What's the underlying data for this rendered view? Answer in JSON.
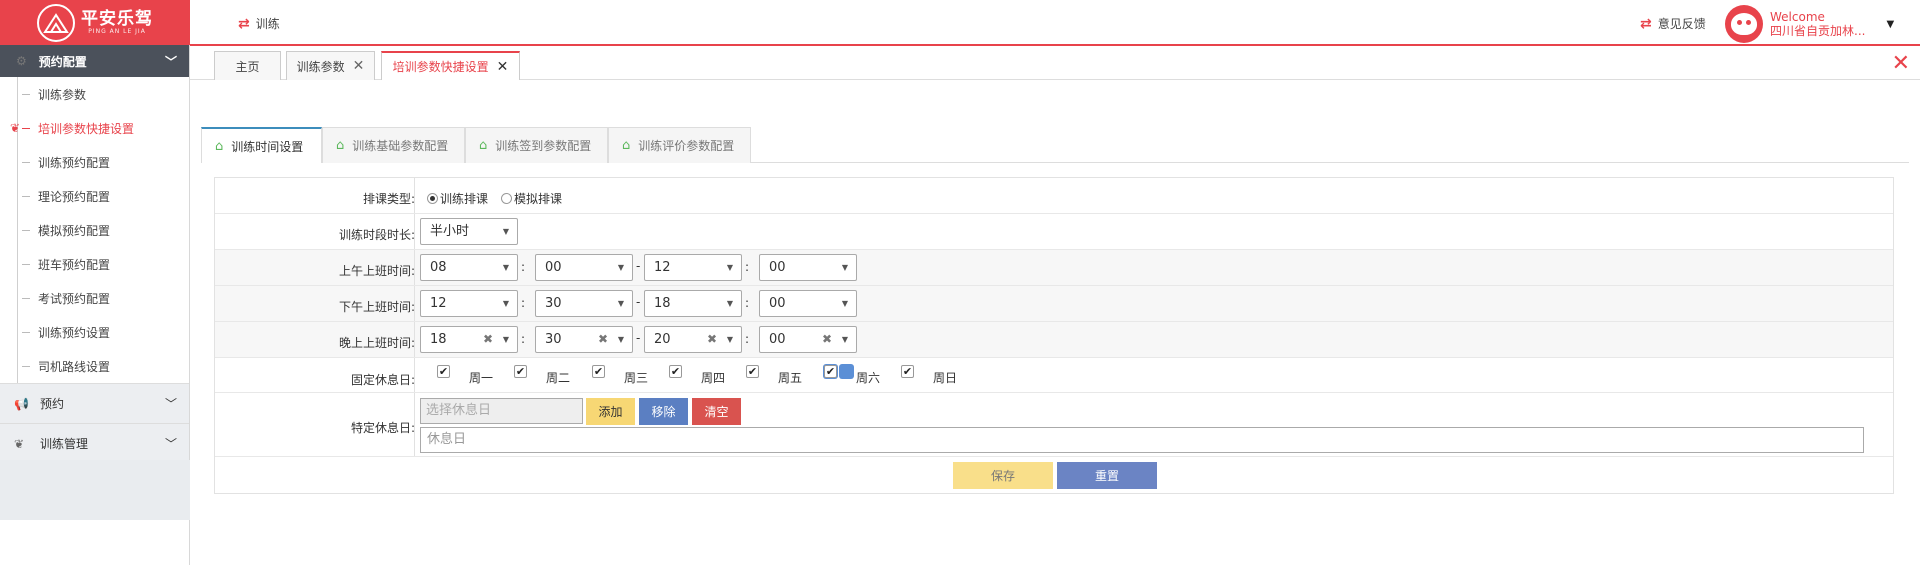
{
  "logo": {
    "name": "平安乐驾",
    "sub": "PING AN LE JIA"
  },
  "header": {
    "nav_label": "训练",
    "feedback_label": "意见反馈",
    "welcome": "Welcome",
    "user_org": "四川省自贡加林..."
  },
  "sidebar": {
    "group_open": "预约配置",
    "items": [
      {
        "label": "训练参数",
        "active": false
      },
      {
        "label": "培训参数快捷设置",
        "active": true
      },
      {
        "label": "训练预约配置",
        "active": false
      },
      {
        "label": "理论预约配置",
        "active": false
      },
      {
        "label": "模拟预约配置",
        "active": false
      },
      {
        "label": "班车预约配置",
        "active": false
      },
      {
        "label": "考试预约配置",
        "active": false
      },
      {
        "label": "训练预约设置",
        "active": false
      },
      {
        "label": "司机路线设置",
        "active": false
      }
    ],
    "groups": [
      {
        "label": "预约",
        "icon": "megaphone-icon"
      },
      {
        "label": "训练管理",
        "icon": "leaf-icon"
      }
    ]
  },
  "tabs": [
    {
      "label": "主页"
    },
    {
      "label": "训练参数"
    },
    {
      "label": "培训参数快捷设置"
    }
  ],
  "inner_tabs": [
    {
      "label": "训练时间设置"
    },
    {
      "label": "训练基础参数配置"
    },
    {
      "label": "训练签到参数配置"
    },
    {
      "label": "训练评价参数配置"
    }
  ],
  "form": {
    "schedule_type": {
      "label": "排课类型:",
      "options": [
        {
          "label": "训练排课",
          "selected": true
        },
        {
          "label": "模拟排课",
          "selected": false
        }
      ]
    },
    "duration": {
      "label": "训练时段时长:",
      "value": "半小时"
    },
    "morning": {
      "label": "上午上班时间:",
      "start_h": "08",
      "start_m": "00",
      "end_h": "12",
      "end_m": "00"
    },
    "afternoon": {
      "label": "下午上班时间:",
      "start_h": "12",
      "start_m": "30",
      "end_h": "18",
      "end_m": "00"
    },
    "evening": {
      "label": "晚上上班时间:",
      "start_h": "18",
      "start_m": "30",
      "end_h": "20",
      "end_m": "00"
    },
    "weekly_rest": {
      "label": "固定休息日:",
      "days": [
        "周一",
        "周二",
        "周三",
        "周四",
        "周五",
        "周六",
        "周日"
      ]
    },
    "special_rest": {
      "label": "特定休息日:",
      "date_placeholder": "选择休息日",
      "add": "添加",
      "remove": "移除",
      "clear": "清空",
      "rest_placeholder": "休息日"
    },
    "save": "保存",
    "reset": "重置",
    "colon": ":",
    "dash": "-"
  },
  "colors": {
    "brand": "#e8434b",
    "add": "#f7d774",
    "remove": "#5b7fc2",
    "clear": "#d9534f",
    "save": "#f9df8a",
    "reset": "#6b84c4"
  }
}
